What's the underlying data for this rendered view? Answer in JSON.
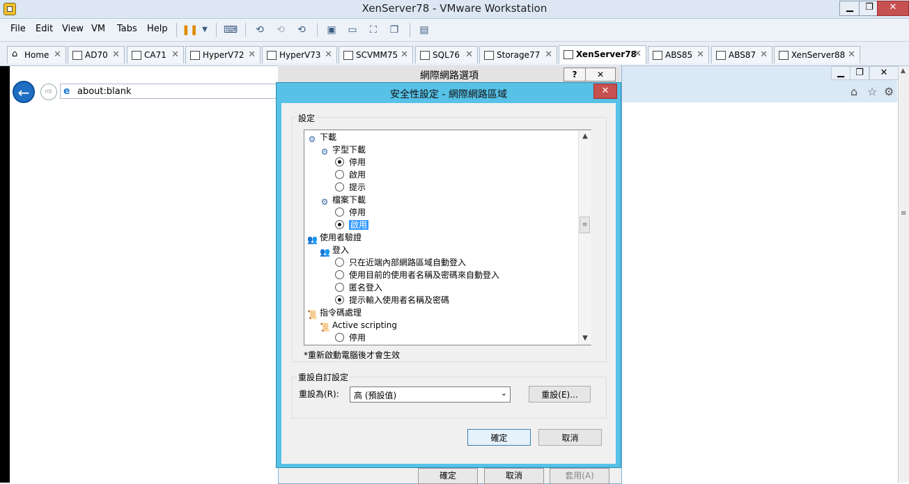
{
  "app": {
    "title": "XenServer78 - VMware Workstation",
    "win_minimize": "▁",
    "win_restore": "❐",
    "win_close": "✕"
  },
  "menu": {
    "file": "File",
    "edit": "Edit",
    "view": "View",
    "vm": "VM",
    "tabs": "Tabs",
    "help": "Help"
  },
  "tabs": [
    {
      "label": "Home",
      "icon": "home-icon"
    },
    {
      "label": "AD70",
      "icon": "vm-icon"
    },
    {
      "label": "CA71",
      "icon": "vm-icon"
    },
    {
      "label": "HyperV72",
      "icon": "vm-running-icon"
    },
    {
      "label": "HyperV73",
      "icon": "vm-running-icon"
    },
    {
      "label": "SCVMM75",
      "icon": "vm-running-icon"
    },
    {
      "label": "SQL76",
      "icon": "vm-running-icon"
    },
    {
      "label": "Storage77",
      "icon": "vm-running-icon"
    },
    {
      "label": "XenServer78",
      "icon": "vm-running-icon",
      "active": true
    },
    {
      "label": "ABS85",
      "icon": "vm-icon"
    },
    {
      "label": "ABS87",
      "icon": "vm-icon"
    },
    {
      "label": "XenServer88",
      "icon": "vm-running-icon"
    }
  ],
  "browser": {
    "address": "about:blank"
  },
  "inet_dialog": {
    "title": "網際網路選項",
    "help": "?",
    "close": "✕",
    "ok": "確定",
    "cancel": "取消",
    "apply": "套用(A)"
  },
  "security_dialog": {
    "title": "安全性設定 - 網際網路區域",
    "close": "✕",
    "settings_label": "設定",
    "tree": [
      {
        "type": "category",
        "label": "下載"
      },
      {
        "type": "subcategory",
        "label": "字型下載"
      },
      {
        "type": "option",
        "label": "停用",
        "checked": true
      },
      {
        "type": "option",
        "label": "啟用",
        "checked": false
      },
      {
        "type": "option",
        "label": "提示",
        "checked": false
      },
      {
        "type": "subcategory",
        "label": "檔案下載"
      },
      {
        "type": "option",
        "label": "停用",
        "checked": false
      },
      {
        "type": "option",
        "label": "啟用",
        "checked": true,
        "selected": true
      },
      {
        "type": "category",
        "label": "使用者驗證"
      },
      {
        "type": "subcategory",
        "label": "登入"
      },
      {
        "type": "option",
        "label": "只在近端內部網路區域自動登入",
        "checked": false
      },
      {
        "type": "option",
        "label": "使用目前的使用者名稱及密碼來自動登入",
        "checked": false
      },
      {
        "type": "option",
        "label": "匿名登入",
        "checked": false
      },
      {
        "type": "option",
        "label": "提示輸入使用者名稱及密碼",
        "checked": true
      },
      {
        "type": "category",
        "label": "指令碼處理"
      },
      {
        "type": "subcategory",
        "label": "Active scripting"
      },
      {
        "type": "option",
        "label": "停用",
        "checked": false
      }
    ],
    "note": "*重新啟動電腦後才會生效",
    "reset_group_label": "重設自訂設定",
    "reset_to_label": "重設為(R):",
    "reset_select_value": "高 (預設值)",
    "reset_button": "重設(E)...",
    "ok": "確定",
    "cancel": "取消"
  }
}
